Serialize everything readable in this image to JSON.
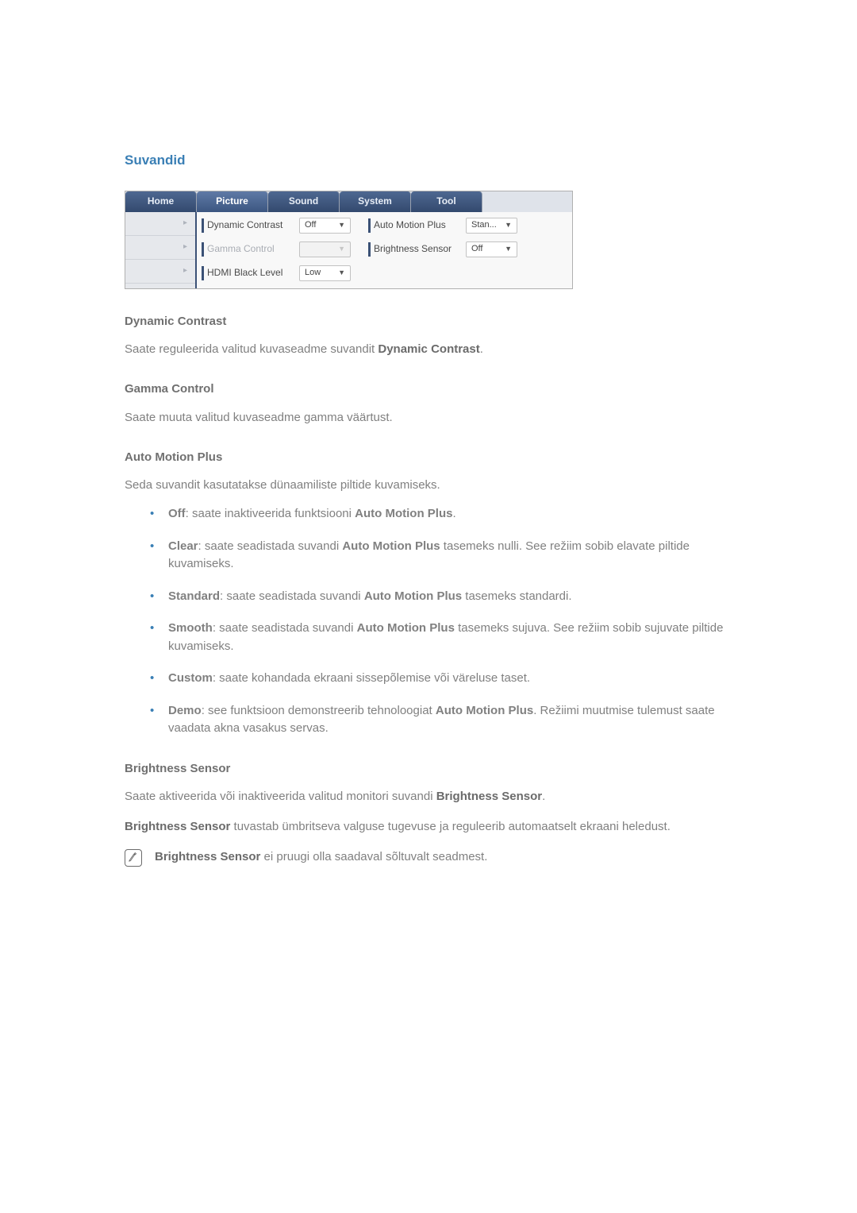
{
  "title": "Suvandid",
  "screenshot": {
    "tabs": [
      "Home",
      "Picture",
      "Sound",
      "System",
      "Tool"
    ],
    "active_tab_index": 1,
    "side_arrows": [
      "▸",
      "▸",
      "▸"
    ],
    "rows": [
      {
        "left": {
          "label": "Dynamic Contrast",
          "value": "Off",
          "disabled": false
        },
        "right": {
          "label": "Auto Motion Plus",
          "value": "Stan...",
          "disabled": false
        }
      },
      {
        "left": {
          "label": "Gamma Control",
          "value": "",
          "disabled": true
        },
        "right": {
          "label": "Brightness Sensor",
          "value": "Off",
          "disabled": false
        }
      },
      {
        "left": {
          "label": "HDMI Black Level",
          "value": "Low",
          "disabled": false
        }
      }
    ]
  },
  "sections": {
    "dynamic": {
      "heading": "Dynamic Contrast",
      "text_before": "Saate reguleerida valitud kuvaseadme suvandit ",
      "bold": "Dynamic Contrast",
      "text_after": "."
    },
    "gamma": {
      "heading": "Gamma Control",
      "text": "Saate muuta valitud kuvaseadme gamma väärtust."
    },
    "amp": {
      "heading": "Auto Motion Plus",
      "intro": "Seda suvandit kasutatakse dünaamiliste piltide kuvamiseks.",
      "items": [
        {
          "b1": "Off",
          "t1": ": saate inaktiveerida funktsiooni ",
          "b2": "Auto Motion Plus",
          "t2": "."
        },
        {
          "b1": "Clear",
          "t1": ": saate seadistada suvandi ",
          "b2": "Auto Motion Plus",
          "t2": " tasemeks nulli. See režiim sobib elavate piltide kuvamiseks."
        },
        {
          "b1": "Standard",
          "t1": ": saate seadistada suvandi ",
          "b2": "Auto Motion Plus",
          "t2": " tasemeks standardi."
        },
        {
          "b1": "Smooth",
          "t1": ": saate seadistada suvandi ",
          "b2": "Auto Motion Plus",
          "t2": " tasemeks sujuva. See režiim sobib sujuvate piltide kuvamiseks."
        },
        {
          "b1": "Custom",
          "t1": ": saate kohandada ekraani sissepõlemise või väreluse taset.",
          "b2": "",
          "t2": ""
        },
        {
          "b1": "Demo",
          "t1": ": see funktsioon demonstreerib tehnoloogiat ",
          "b2": "Auto Motion Plus",
          "t2": ". Režiimi muutmise tulemust saate vaadata akna vasakus servas."
        }
      ]
    },
    "bsensor": {
      "heading": "Brightness Sensor",
      "p1_before": "Saate aktiveerida või inaktiveerida valitud monitori suvandi ",
      "p1_bold": "Brightness Sensor",
      "p1_after": ".",
      "p2_bold": "Brightness Sensor",
      "p2_after": " tuvastab ümbritseva valguse tugevuse ja reguleerib automaatselt ekraani heledust.",
      "note_bold": "Brightness Sensor",
      "note_after": " ei pruugi olla saadaval sõltuvalt seadmest."
    }
  }
}
